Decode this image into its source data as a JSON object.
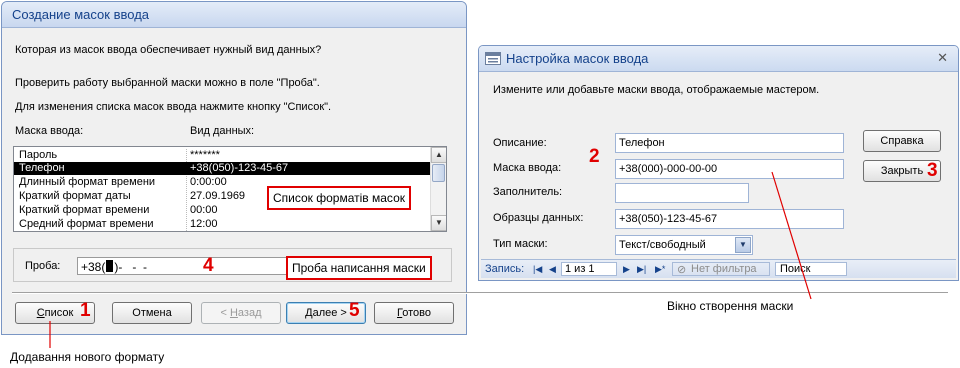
{
  "dialog1": {
    "title": "Создание масок ввода",
    "question": "Которая из масок ввода обеспечивает нужный вид данных?",
    "check_hint": "Проверить работу выбранной маски можно в поле \"Проба\".",
    "list_hint": "Для изменения списка масок ввода нажмите кнопку \"Список\".",
    "col_mask": "Маска ввода:",
    "col_view": "Вид данных:",
    "rows": [
      {
        "mask": "Пароль",
        "view": "*******"
      },
      {
        "mask": "Телефон",
        "view": "+38(050)-123-45-67"
      },
      {
        "mask": "Длинный формат времени",
        "view": "0:00:00"
      },
      {
        "mask": "Краткий формат даты",
        "view": "27.09.1969"
      },
      {
        "mask": "Краткий формат времени",
        "view": "00:00"
      },
      {
        "mask": "Средний формат времени",
        "view": "12:00"
      }
    ],
    "selected_row": 1,
    "proba_label": "Проба:",
    "proba_prefix": "+38(",
    "proba_suffix": ")-   -  -",
    "buttons": {
      "list_u": "С",
      "list_rest": "писок",
      "cancel": "Отмена",
      "back_prefix": "< ",
      "back_u": "Н",
      "back_rest": "азад",
      "next_u": "Д",
      "next_rest": "алее >",
      "finish_u": "Г",
      "finish_rest": "отово"
    }
  },
  "dialog2": {
    "title": "Настройка масок ввода",
    "close_glyph": "✕",
    "instruction": "Измените или добавьте маски ввода, отображаемые мастером.",
    "fields": {
      "description_label": "Описание:",
      "description_value": "Телефон",
      "mask_label": "Маска ввода:",
      "mask_value": "+38(000)-000-00-00",
      "placeholder_label": "Заполнитель:",
      "placeholder_value": "",
      "sample_label": "Образцы данных:",
      "sample_value": "+38(050)-123-45-67",
      "type_label": "Тип маски:",
      "type_value": "Текст/свободный"
    },
    "help_button": "Справка",
    "close_button": "Закрыть",
    "navbar": {
      "record_label": "Запись:",
      "record_position": "1 из 1",
      "filter": "Нет фильтра",
      "search": "Поиск"
    }
  },
  "annotations": {
    "callout_list": "Список форматів масок",
    "callout_proba": "Проба написання маски",
    "caption_window": "Вікно створення маски",
    "caption_add": "Додавання нового формату",
    "n1": "1",
    "n2": "2",
    "n3": "3",
    "n4": "4",
    "n5": "5"
  },
  "colors": {
    "accent_red": "#e00000",
    "title_blue": "#15428b",
    "selection": "#000000"
  }
}
